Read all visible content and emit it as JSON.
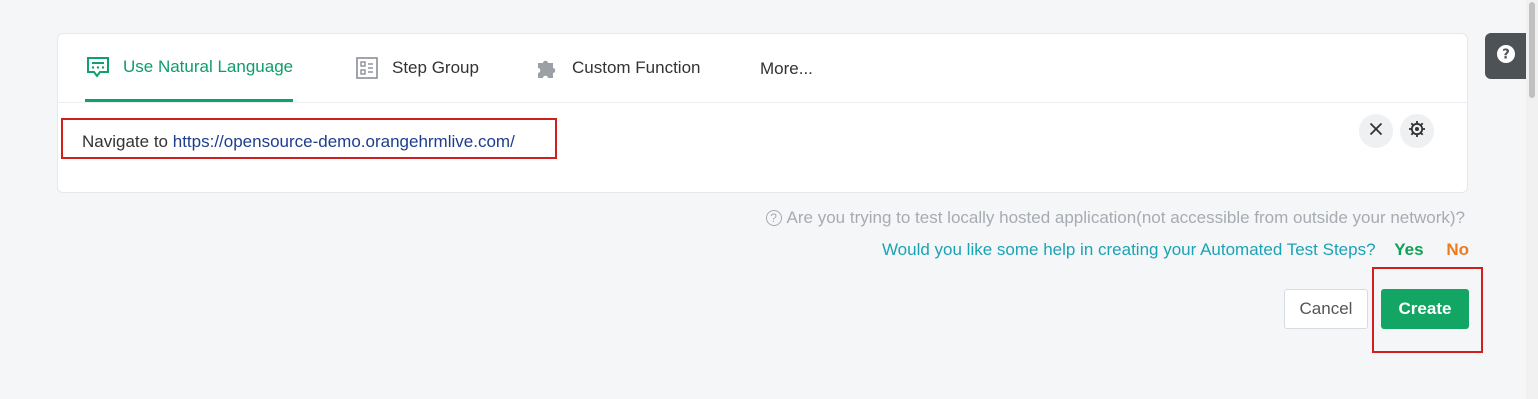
{
  "tabs": [
    {
      "label": "Use Natural Language",
      "icon": "chat-steps-icon",
      "active": true
    },
    {
      "label": "Step Group",
      "icon": "step-group-icon",
      "active": false
    },
    {
      "label": "Custom Function",
      "icon": "puzzle-icon",
      "active": false
    },
    {
      "label": "More...",
      "active": false
    }
  ],
  "editor": {
    "prefix": "Navigate to ",
    "url": "https://opensource-demo.orangehrmlive.com/"
  },
  "hint": {
    "text": "Are you trying to test locally hosted application(not accessible from outside your network)?",
    "icon": "question-circle-icon"
  },
  "help_prompt": {
    "text": "Would you like some help in creating your Automated Test Steps?",
    "yes": "Yes",
    "no": "No"
  },
  "actions": {
    "cancel": "Cancel",
    "create": "Create"
  },
  "colors": {
    "accent": "#0fa06b",
    "create_button": "#12a563",
    "link_text": "#1ba3b5",
    "url_text": "#1e3d8f",
    "no_option": "#ef7a1a",
    "annotation_box": "#d01f1f"
  }
}
